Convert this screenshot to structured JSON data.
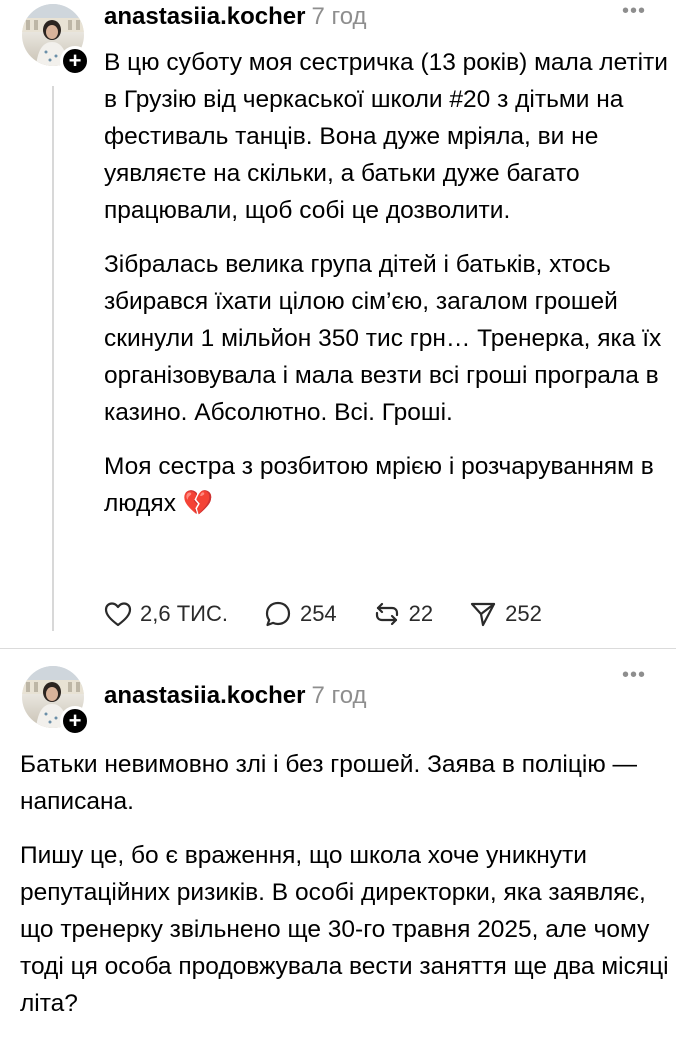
{
  "posts": [
    {
      "username": "anastasiia.kocher",
      "time": "7 год",
      "more_label": "•••",
      "paragraphs": [
        "В цю суботу моя сестричка (13 років) мала летіти в Грузію від черкаської школи #20 з дітьми на фестиваль танців. Вона дуже мріяла, ви не уявляєте на скільки, а батьки дуже багато працювали, щоб собі це дозволити.",
        "Зібралась велика група дітей і батьків, хтось збирався їхати цілою сім’єю, загалом грошей скинули 1 мільйон 350 тис грн… Тренерка, яка їх організовувала і мала везти всі гроші програла в казино. Абсолютно. Всі. Гроші.",
        "Моя сестра з розбитою мрією і розчаруванням в людях"
      ],
      "emoji": "💔",
      "actions": {
        "likes": "2,6 ТИС.",
        "replies": "254",
        "reposts": "22",
        "shares": "252"
      }
    },
    {
      "username": "anastasiia.kocher",
      "time": "7 год",
      "more_label": "•••",
      "paragraphs": [
        "Батьки невимовно злі і без грошей. Заява в поліцію — написана.",
        "Пишу це, бо є враження, що школа хоче уникнути репутаційних ризиків. В особі директорки, яка заявляє, що тренерку звільнено ще 30-го травня 2025, але чому тоді ця особа продовжувала вести заняття ще два місяці літа?"
      ]
    }
  ],
  "icons": {
    "like": "heart-icon",
    "reply": "comment-icon",
    "repost": "repost-icon",
    "share": "share-icon",
    "follow": "plus-icon",
    "more": "more-icon"
  },
  "colors": {
    "text": "#000000",
    "secondary": "#8e8e8e",
    "divider": "#dbdbdb",
    "heart": "#d8203b"
  }
}
